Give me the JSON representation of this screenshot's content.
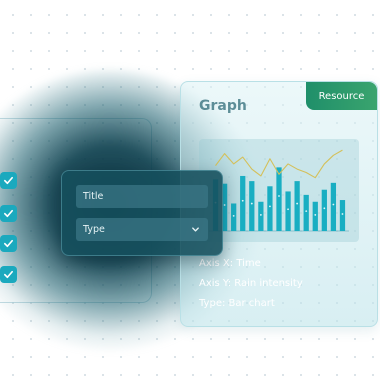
{
  "colors": {
    "accent": "#1ba9be",
    "resource_button": "#2f9b6c",
    "form_card": "#144e5c"
  },
  "left_panel": {
    "checkbox_count": 4,
    "icon": "check-icon"
  },
  "graph_card": {
    "title": "Graph",
    "resource_label": "Resource",
    "axis_x": "Axis X: Time",
    "axis_y": "Axis Y: Rain intensity",
    "type": "Type: Bar chart"
  },
  "form": {
    "title_field": "Title",
    "type_field": "Type",
    "type_icon": "chevron-down-icon"
  },
  "chart_data": {
    "type": "bar",
    "values": [
      6,
      5.5,
      3.2,
      6.4,
      5.8,
      3.4,
      5.2,
      7.4,
      4.6,
      5.8,
      4.2,
      3.4,
      4.8,
      5.6,
      3.6
    ],
    "line": [
      7.6,
      9,
      7.8,
      8.6,
      7.2,
      6.4,
      8.4,
      6.6,
      7.8,
      7.2,
      6.8,
      6.2,
      7.8,
      8.8,
      9.4
    ],
    "ylim": [
      0,
      10
    ]
  }
}
